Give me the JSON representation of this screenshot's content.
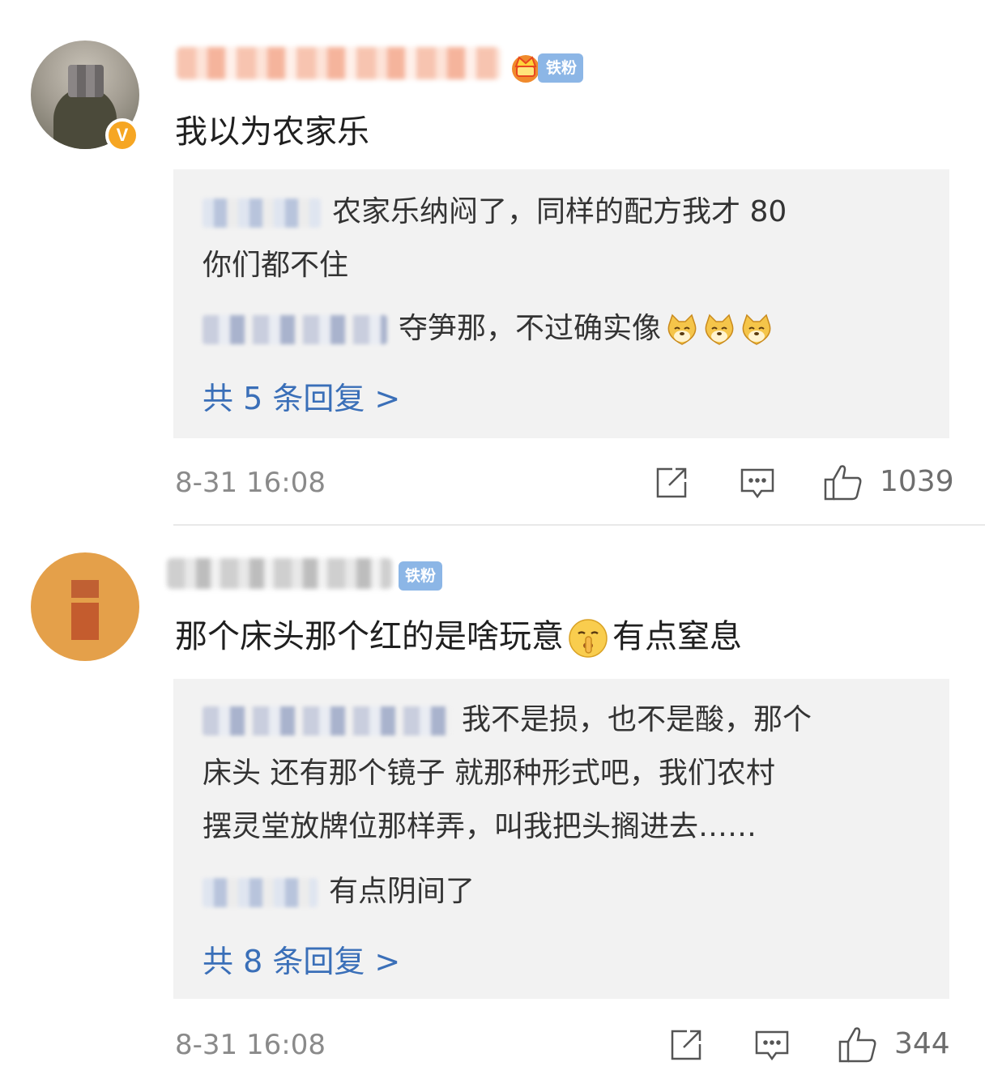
{
  "comments": [
    {
      "badge_label": "铁粉",
      "verified_mark": "V",
      "text": "我以为农家乐",
      "replies": [
        {
          "text_line1": "农家乐纳闷了，同样的配方我才 80",
          "text_line2": "你们都不住"
        },
        {
          "text": "夺笋那，不过确实像"
        }
      ],
      "more_replies": "共 5 条回复 >",
      "timestamp": "8-31 16:08",
      "likes": "1039"
    },
    {
      "badge_label": "铁粉",
      "text_before": "那个床头那个红的是啥玩意",
      "text_after": "有点窒息",
      "replies": [
        {
          "text_line1": "我不是损，也不是酸，那个",
          "text_line2": "床头 还有那个镜子 就那种形式吧，我们农村",
          "text_line3": "摆灵堂放牌位那样弄，叫我把头搁进去……"
        },
        {
          "text": "有点阴间了"
        }
      ],
      "more_replies": "共 8 条回复 >",
      "timestamp": "8-31 16:08",
      "likes": "344"
    }
  ],
  "icons": {
    "share": "share-icon",
    "comment": "comment-icon",
    "like": "thumbs-up-icon",
    "doge_emoji": "doge-emoji-icon",
    "shush_emoji": "shush-emoji-icon",
    "crown": "crown-badge-icon"
  },
  "colors": {
    "link": "#3a6fb8",
    "badge": "#8cb6e6",
    "verified": "#f6a623",
    "reply_bg": "#f2f2f2"
  }
}
